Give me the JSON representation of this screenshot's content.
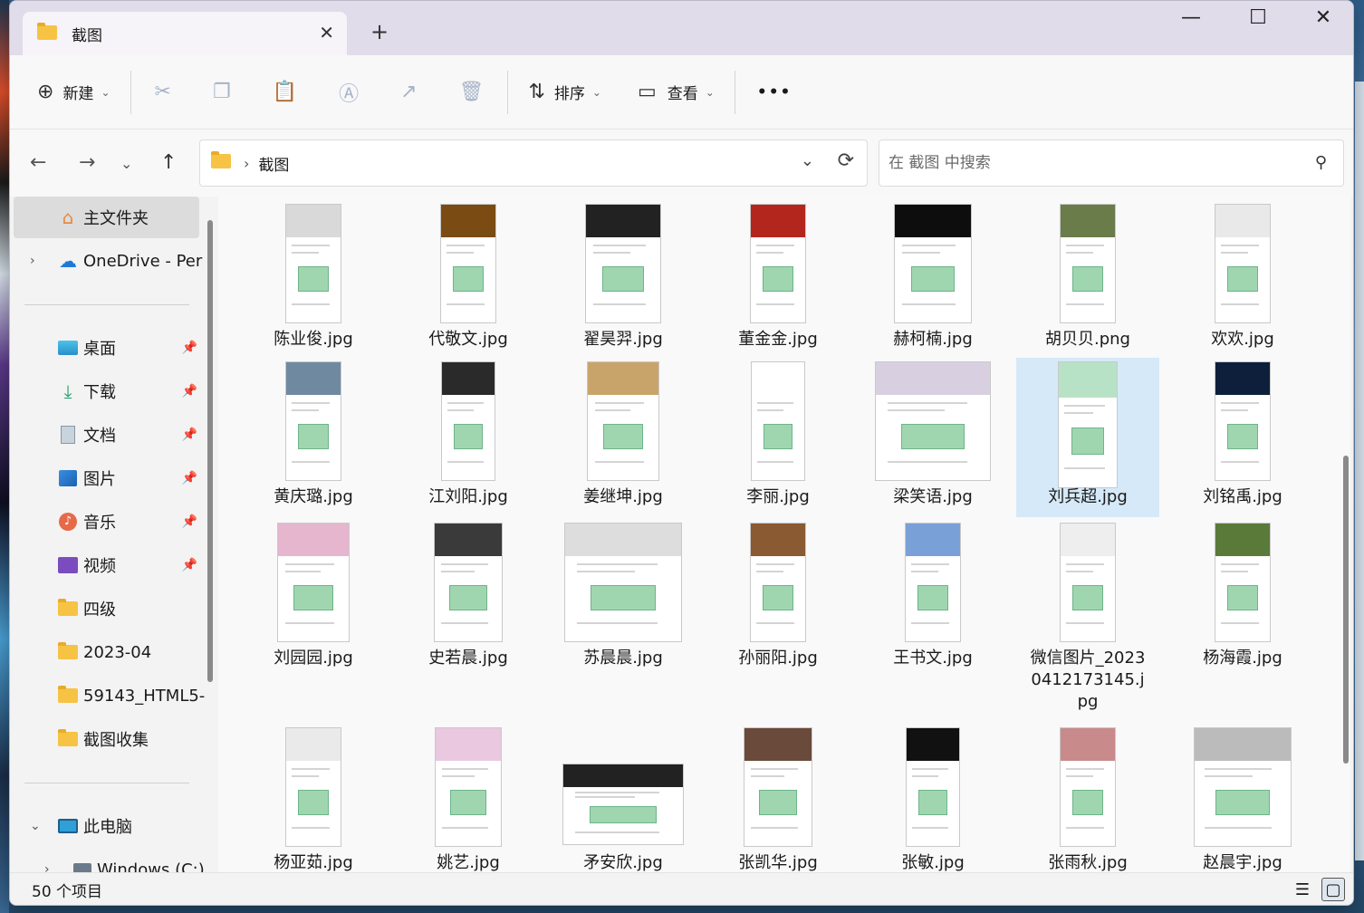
{
  "window": {
    "tab_title": "截图",
    "controls": {
      "minimize": "—",
      "maximize": "☐",
      "close": "✕"
    },
    "new_tab": "+"
  },
  "toolbar": {
    "new_label": "新建",
    "sort_label": "排序",
    "view_label": "查看",
    "more": "•••"
  },
  "address": {
    "crumb": "截图",
    "search_placeholder": "在 截图 中搜索"
  },
  "sidebar": {
    "home": "主文件夹",
    "onedrive": "OneDrive - Per",
    "quick": [
      {
        "label": "桌面",
        "icon": "desktop-icon",
        "pinned": true
      },
      {
        "label": "下载",
        "icon": "download-icon",
        "pinned": true
      },
      {
        "label": "文档",
        "icon": "document-icon",
        "pinned": true
      },
      {
        "label": "图片",
        "icon": "pictures-icon",
        "pinned": true
      },
      {
        "label": "音乐",
        "icon": "music-icon",
        "pinned": true
      },
      {
        "label": "视频",
        "icon": "video-icon",
        "pinned": true
      },
      {
        "label": "四级",
        "icon": "folder-icon",
        "pinned": false
      },
      {
        "label": "2023-04",
        "icon": "folder-icon",
        "pinned": false
      },
      {
        "label": "59143_HTML5-",
        "icon": "folder-icon",
        "pinned": false
      },
      {
        "label": "截图收集",
        "icon": "folder-icon",
        "pinned": false
      }
    ],
    "this_pc": "此电脑",
    "drive": "Windows (C:)"
  },
  "files": [
    [
      "陈业俊.jpg",
      "代敬文.jpg",
      "翟昊羿.jpg",
      "董金金.jpg",
      "赫柯楠.jpg",
      "胡贝贝.png",
      "欢欢.jpg"
    ],
    [
      "黄庆璐.jpg",
      "江刘阳.jpg",
      "姜继坤.jpg",
      "李丽.jpg",
      "梁笑语.jpg",
      "刘兵超.jpg",
      "刘铭禹.jpg"
    ],
    [
      "刘园园.jpg",
      "史若晨.jpg",
      "苏晨晨.jpg",
      "孙丽阳.jpg",
      "王书文.jpg",
      "微信图片_20230412173145.jpg",
      "杨海霞.jpg"
    ],
    [
      "杨亚茹.jpg",
      "姚艺.jpg",
      "矛安欣.jpg",
      "张凯华.jpg",
      "张敏.jpg",
      "张雨秋.jpg",
      "赵晨宇.jpg"
    ]
  ],
  "selected_file": "刘兵超.jpg",
  "status": {
    "count": "50 个项目"
  }
}
